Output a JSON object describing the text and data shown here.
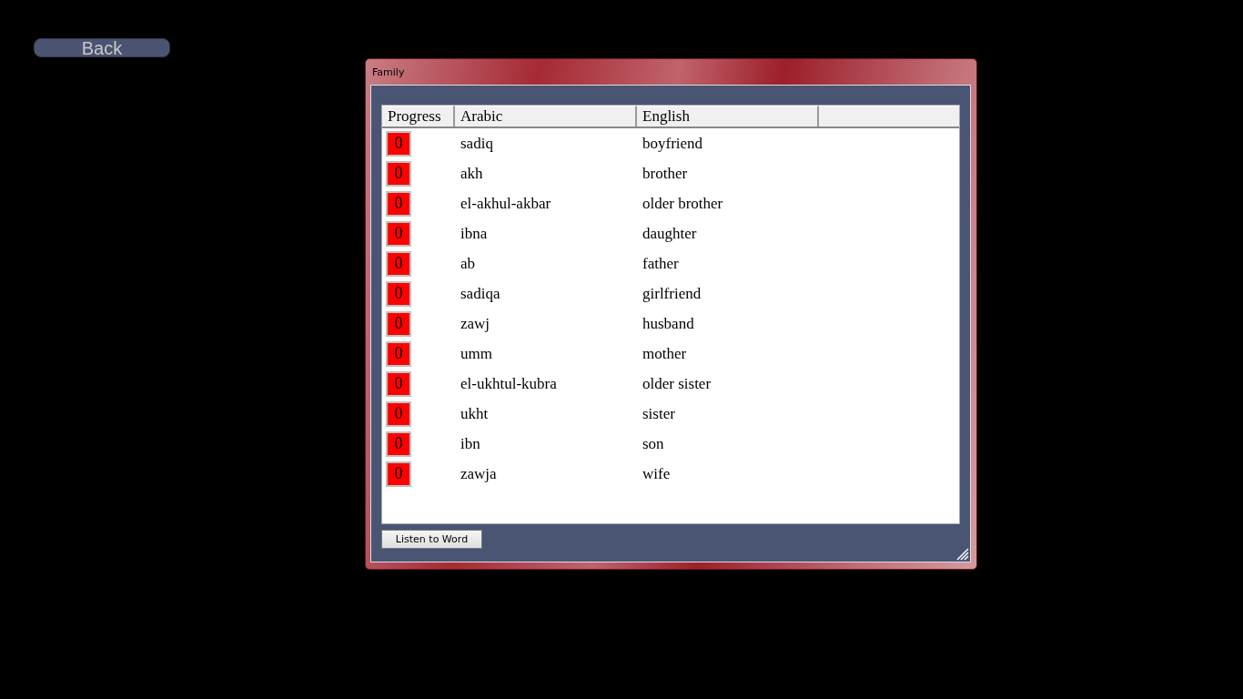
{
  "back_button": "Back",
  "window": {
    "title": "Family"
  },
  "table": {
    "columns": [
      "Progress",
      "Arabic",
      "English"
    ],
    "rows": [
      {
        "progress": "0",
        "color": "#ff0000",
        "arabic": "sadiq",
        "english": "boyfriend"
      },
      {
        "progress": "0",
        "color": "#ff0000",
        "arabic": "akh",
        "english": "brother"
      },
      {
        "progress": "0",
        "color": "#ff0000",
        "arabic": "el-akhul-akbar",
        "english": "older brother"
      },
      {
        "progress": "0",
        "color": "#ff0000",
        "arabic": "ibna",
        "english": "daughter"
      },
      {
        "progress": "0",
        "color": "#ff0000",
        "arabic": "ab",
        "english": "father"
      },
      {
        "progress": "0",
        "color": "#ff0000",
        "arabic": "sadiqa",
        "english": "girlfriend"
      },
      {
        "progress": "0",
        "color": "#ff0000",
        "arabic": "zawj",
        "english": "husband"
      },
      {
        "progress": "0",
        "color": "#ff0000",
        "arabic": "umm",
        "english": "mother"
      },
      {
        "progress": "0",
        "color": "#ff0000",
        "arabic": "el-ukhtul-kubra",
        "english": "older sister"
      },
      {
        "progress": "0",
        "color": "#ff0000",
        "arabic": "ukht",
        "english": "sister"
      },
      {
        "progress": "0",
        "color": "#ff0000",
        "arabic": "ibn",
        "english": "son"
      },
      {
        "progress": "0",
        "color": "#ff0000",
        "arabic": "zawja",
        "english": "wife"
      }
    ]
  },
  "listen_button": "Listen to Word"
}
